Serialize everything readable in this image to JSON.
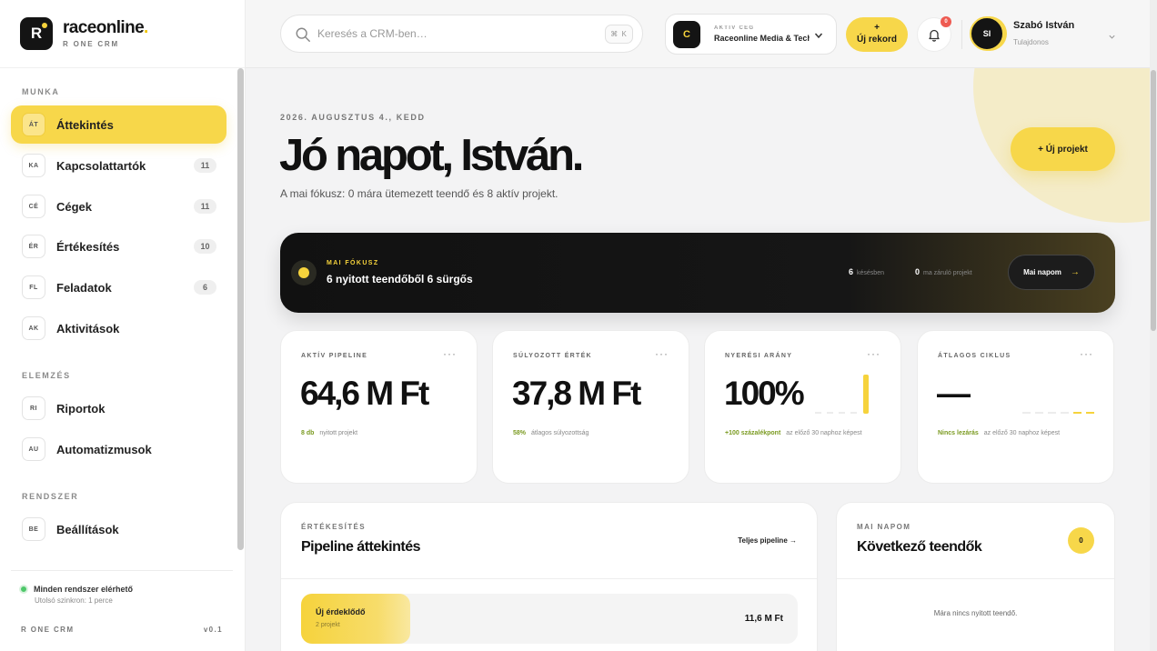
{
  "brand": {
    "logo_letter": "R",
    "name": "raceonline",
    "name_dot": ".",
    "subtitle": "R ONE CRM"
  },
  "sidebar": {
    "sections": [
      {
        "label": "MUNKA"
      },
      {
        "label": "ELEMZÉS"
      },
      {
        "label": "RENDSZER"
      }
    ],
    "items": [
      {
        "code": "ÁT",
        "label": "Áttekintés",
        "count": "",
        "active": true
      },
      {
        "code": "KA",
        "label": "Kapcsolattartók",
        "count": "11"
      },
      {
        "code": "CÉ",
        "label": "Cégek",
        "count": "11"
      },
      {
        "code": "ÉR",
        "label": "Értékesítés",
        "count": "10"
      },
      {
        "code": "FL",
        "label": "Feladatok",
        "count": "6"
      },
      {
        "code": "AK",
        "label": "Aktivitások",
        "count": ""
      },
      {
        "code": "RI",
        "label": "Riportok",
        "count": ""
      },
      {
        "code": "AU",
        "label": "Automatizmusok",
        "count": ""
      },
      {
        "code": "BE",
        "label": "Beállítások",
        "count": ""
      }
    ],
    "status": {
      "text": "Minden rendszer elérhető",
      "sync": "Utolsó szinkron: 1 perce"
    },
    "footer": {
      "product": "R ONE CRM",
      "version": "v0.1"
    }
  },
  "header": {
    "search_placeholder": "Keresés a CRM-ben…",
    "search_shortcut": "⌘ K",
    "company": {
      "logo_letter": "C",
      "label": "AKTÍV CÉG",
      "name": "Raceonline Media & Tech"
    },
    "new_record_plus": "+",
    "new_record_label": "Új rekord",
    "notifications_count": "0",
    "user": {
      "initials": "SI",
      "name": "Szabó István",
      "role": "Tulajdonos"
    }
  },
  "main": {
    "date": "2026. AUGUSZTUS 4., KEDD",
    "greeting": "Jó napot, István.",
    "focus_line": "A mai fókusz: 0 mára ütemezett teendő és 8 aktív projekt.",
    "new_project": "+   Új projekt",
    "focus": {
      "label": "MAI FÓKUSZ",
      "title": "6 nyitott teendőből 6 sürgős",
      "late_count": "6",
      "late_text": "késésben",
      "closing_count": "0",
      "closing_text": "ma záruló projekt",
      "button": "Mai napom",
      "button_arrow": "→"
    },
    "kpis": [
      {
        "label": "AKTÍV PIPELINE",
        "value": "64,6 M Ft",
        "foot_strong": "8 db",
        "foot": "nyitott projekt"
      },
      {
        "label": "SÚLYOZOTT ÉRTÉK",
        "value": "37,8 M Ft",
        "foot_strong": "58%",
        "foot": "átlagos súlyozottság"
      },
      {
        "label": "NYERÉSI ARÁNY",
        "value": "100%",
        "foot_strong": "+100 százalékpont",
        "foot": "az előző 30 naphoz képest"
      },
      {
        "label": "ÁTLAGOS CIKLUS",
        "value": "—",
        "foot_strong": "Nincs lezárás",
        "foot": "az előző 30 naphoz képest"
      }
    ],
    "kpi_more": "···",
    "pipeline": {
      "label": "ÉRTÉKESÍTÉS",
      "title": "Pipeline áttekintés",
      "link": "Teljes pipeline →",
      "stages": [
        {
          "name": "Új érdeklődő",
          "count": "2 projekt",
          "value": "11,6 M Ft",
          "share": 0.22
        }
      ]
    },
    "todos": {
      "label": "MAI NAPOM",
      "title": "Következő teendők",
      "count": "0",
      "empty": "Mára nincs nyitott teendő."
    }
  },
  "colors": {
    "accent": "#f7d74a",
    "dark": "#141414",
    "success": "#4ec86a",
    "alert": "#ee5b52"
  }
}
